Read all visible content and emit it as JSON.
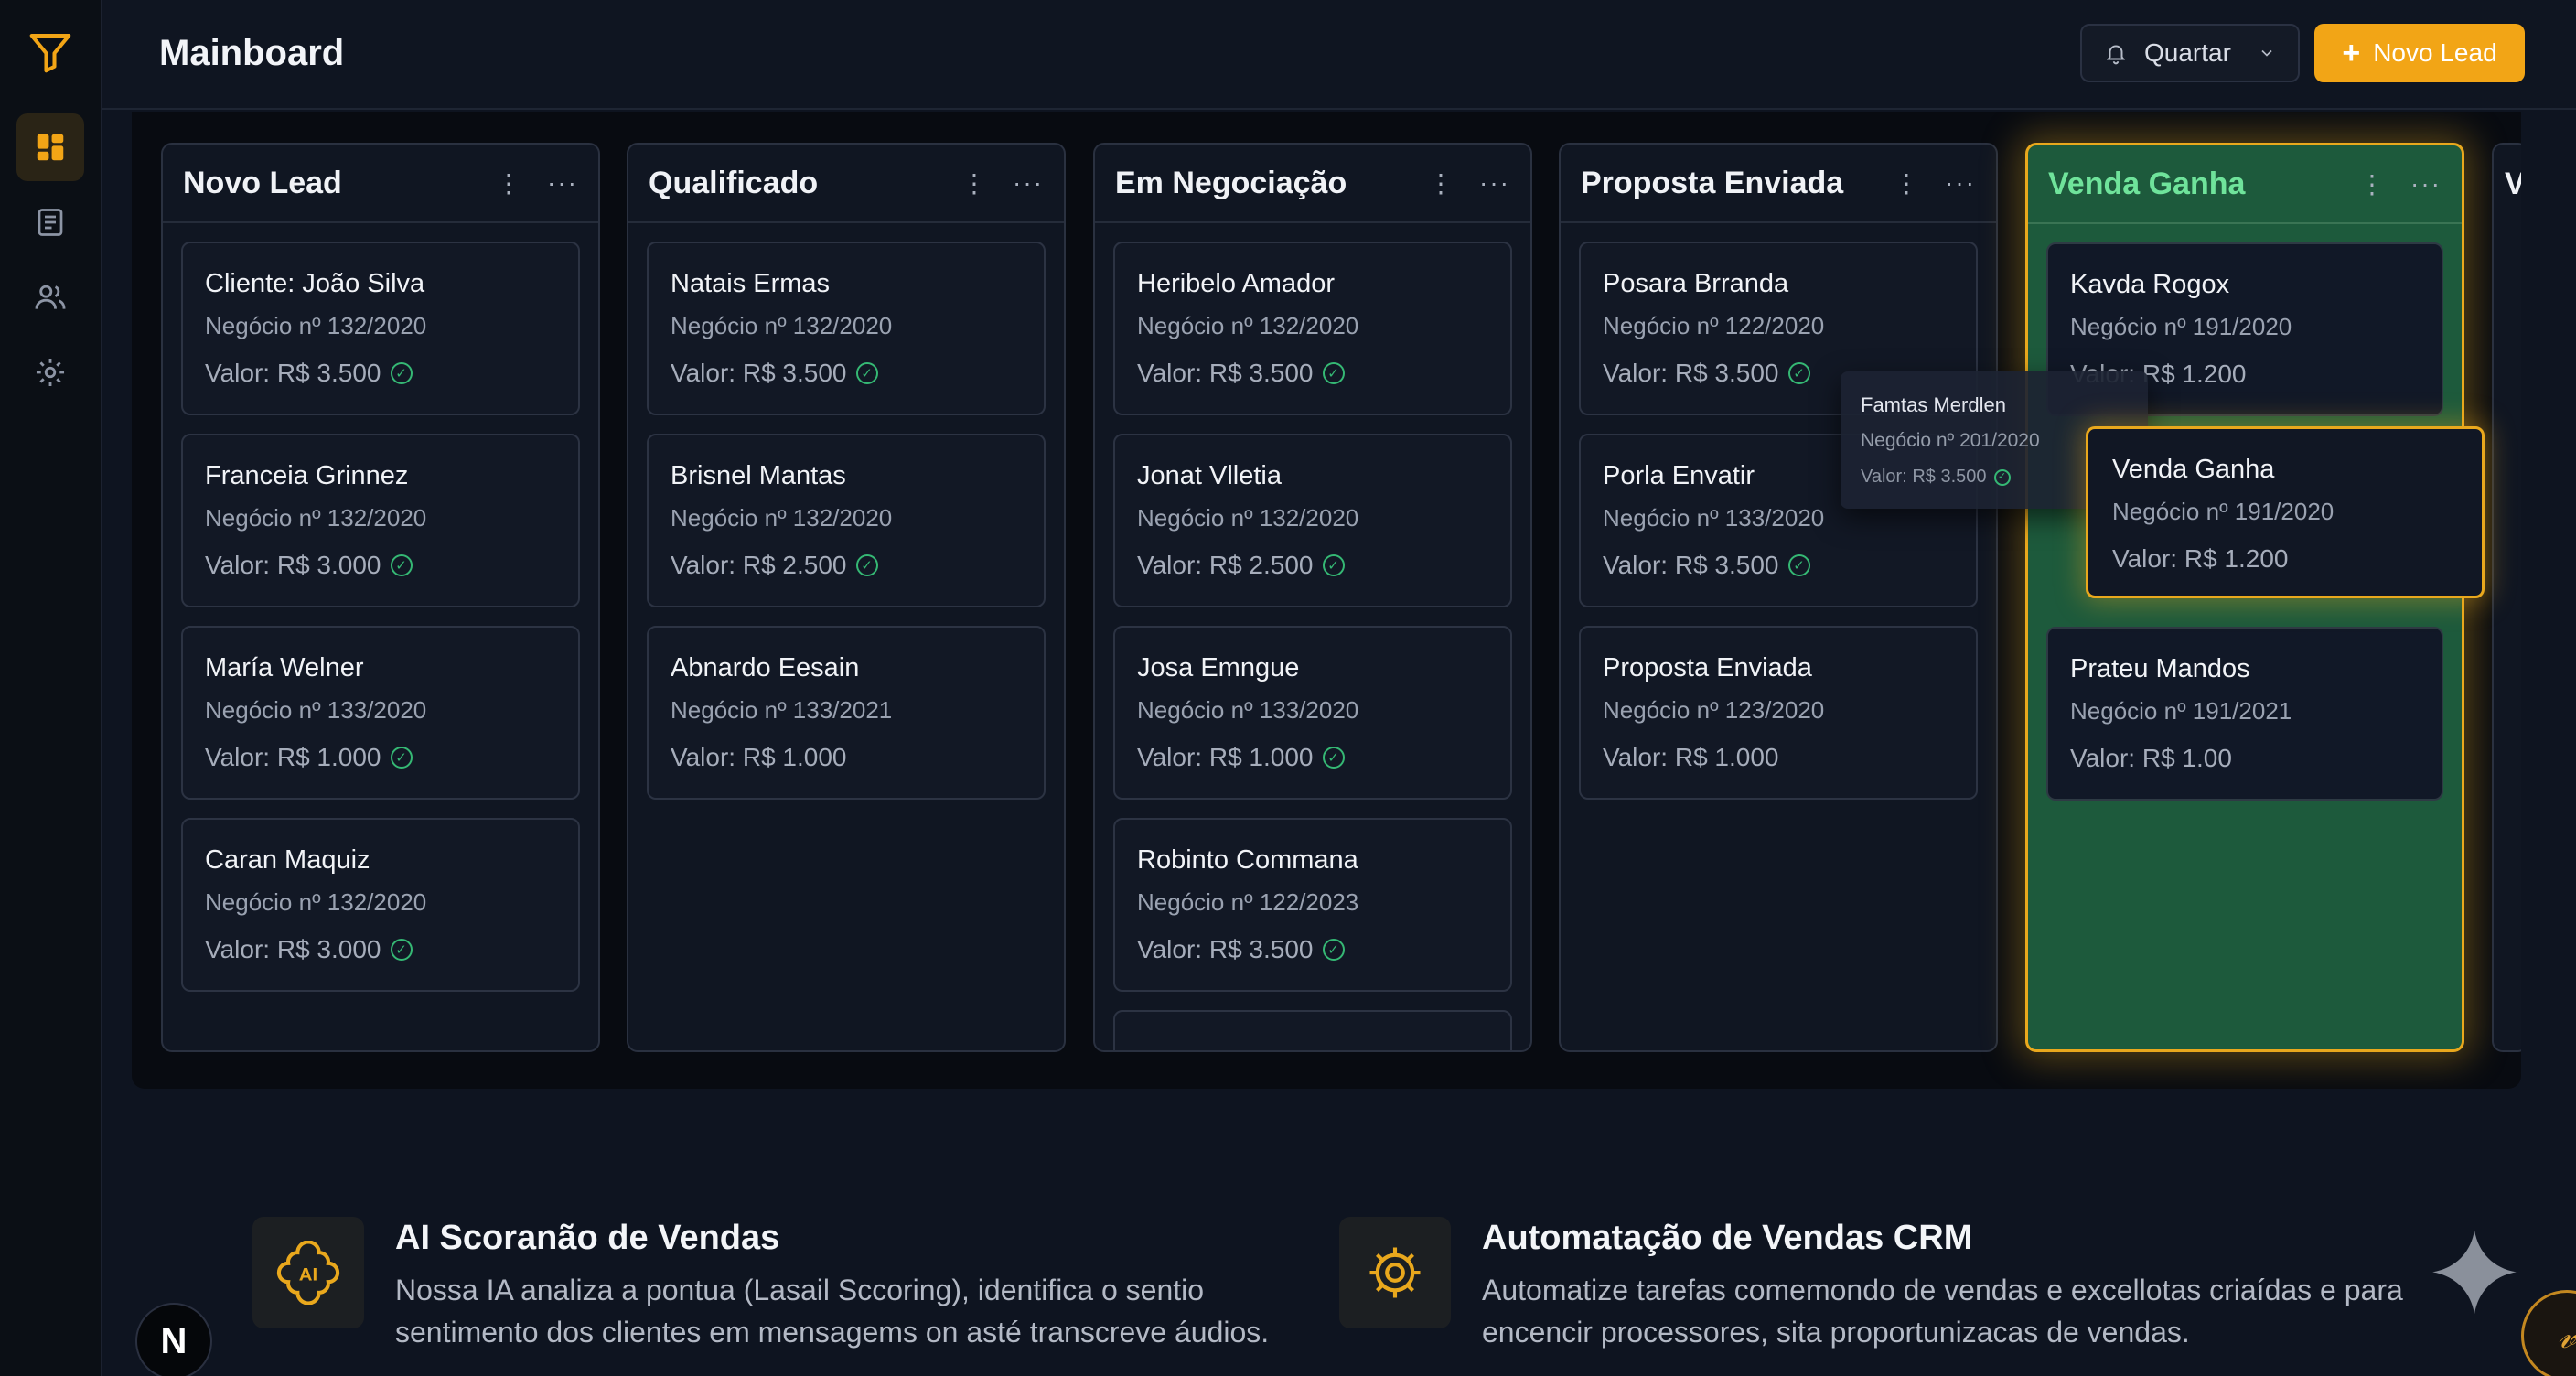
{
  "header": {
    "title": "Mainboard",
    "user_select": "Quartar",
    "new_lead_button": "Novo Lead"
  },
  "sidebar": {
    "items": [
      {
        "icon": "dashboard-icon",
        "active": true
      },
      {
        "icon": "document-icon",
        "active": false
      },
      {
        "icon": "users-icon",
        "active": false
      },
      {
        "icon": "gear-icon",
        "active": false
      }
    ],
    "avatar": "N"
  },
  "columns": [
    {
      "title": "Novo Lead",
      "cards": [
        {
          "name": "Cliente: João Silva",
          "deal": "Negócio nº 132/2020",
          "value": "Valor: R$ 3.500",
          "checked": true
        },
        {
          "name": "Franceia Grinnez",
          "deal": "Negócio nº 132/2020",
          "value": "Valor: R$ 3.000",
          "checked": true
        },
        {
          "name": "María Welner",
          "deal": "Negócio nº 133/2020",
          "value": "Valor: R$ 1.000",
          "checked": true
        },
        {
          "name": "Caran Maquiz",
          "deal": "Negócio nº 132/2020",
          "value": "Valor: R$ 3.000",
          "checked": true
        }
      ]
    },
    {
      "title": "Qualificado",
      "cards": [
        {
          "name": "Natais Ermas",
          "deal": "Negócio nº 132/2020",
          "value": "Valor: R$ 3.500",
          "checked": true
        },
        {
          "name": "Brisnel Mantas",
          "deal": "Negócio nº 132/2020",
          "value": "Valor: R$ 2.500",
          "checked": true
        },
        {
          "name": "Abnardo Eesain",
          "deal": "Negócio nº 133/2021",
          "value": "Valor: R$ 1.000",
          "checked": false
        }
      ]
    },
    {
      "title": "Em Negociação",
      "cards": [
        {
          "name": "Heribelo Amador",
          "deal": "Negócio nº 132/2020",
          "value": "Valor: R$ 3.500",
          "checked": true
        },
        {
          "name": "Jonat Vlletia",
          "deal": "Negócio nº 132/2020",
          "value": "Valor: R$ 2.500",
          "checked": true
        },
        {
          "name": "Josa Emngue",
          "deal": "Negócio nº 133/2020",
          "value": "Valor: R$ 1.000",
          "checked": true
        },
        {
          "name": "Robinto Commana",
          "deal": "Negócio nº 122/2023",
          "value": "Valor: R$ 3.500",
          "checked": true
        }
      ]
    },
    {
      "title": "Proposta Enviada",
      "cards": [
        {
          "name": "Posara Brranda",
          "deal": "Negócio nº 122/2020",
          "value": "Valor: R$ 3.500",
          "checked": true
        },
        {
          "name": "Porla Envatir",
          "deal": "Negócio nº 133/2020",
          "value": "Valor: R$ 3.500",
          "checked": true
        },
        {
          "name": "Proposta Enviada",
          "deal": "Negócio nº 123/2020",
          "value": "Valor: R$ 1.000",
          "checked": false
        }
      ]
    },
    {
      "title": "Venda Ganha",
      "cards": [
        {
          "name": "Kavda Rogox",
          "deal": "Negócio nº 191/2020",
          "value": "Valor: R$ 1.200",
          "checked": false
        },
        {
          "name": "",
          "deal": "",
          "value": "",
          "checked": false
        },
        {
          "name": "Prateu Mandos",
          "deal": "Negócio nº 191/2021",
          "value": "Valor: R$ 1.00",
          "checked": false
        }
      ]
    }
  ],
  "partial_column_title": "V",
  "drag_ghost": {
    "name": "Famtas Merdlen",
    "deal": "Negócio nº 201/2020",
    "value": "Valor: R$ 3.500"
  },
  "drop_card": {
    "name": "Venda Ganha",
    "deal": "Negócio nº 191/2020",
    "value": "Valor: R$ 1.200"
  },
  "features": [
    {
      "icon": "ai-icon",
      "title": "AI Scoranão de Vendas",
      "description": "Nossa IA analiza a pontua (Lasail Sccoring), identifica o sentio sentimento dos clientes em mensagems on asté transcreve áudios."
    },
    {
      "icon": "gear-icon",
      "title": "Automatação de Vendas CRM",
      "description": "Automatize tarefas comemondo de vendas e excellotas criaídas e para encencir processores, sita proportunizacas de vendas."
    }
  ],
  "corner_badge": "𝓋",
  "colors": {
    "accent": "#f2a516",
    "won_column": "#1d5a3c",
    "won_title": "#6fe39b",
    "check": "#35b874"
  }
}
